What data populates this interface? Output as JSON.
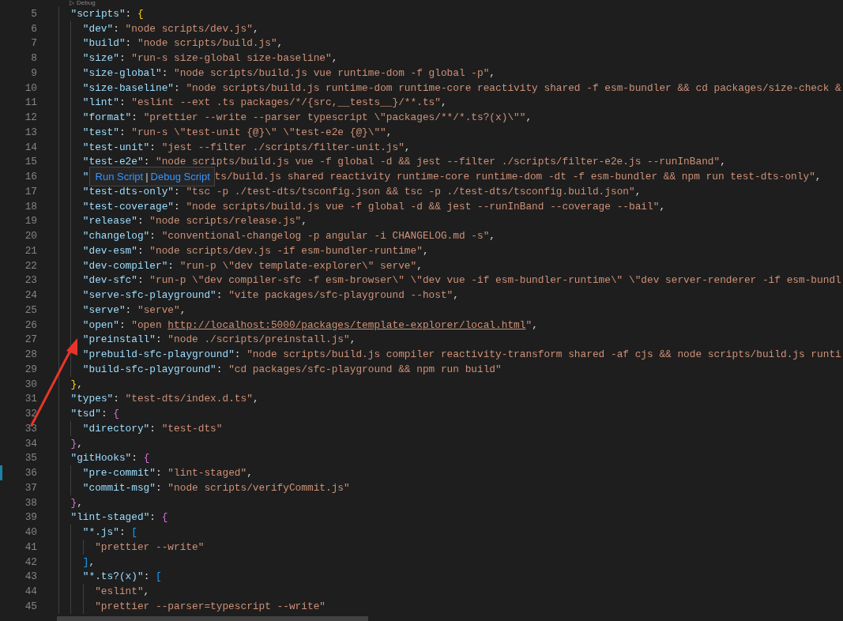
{
  "codelens": {
    "icon": "▷",
    "label": "Debug"
  },
  "lines": [
    {
      "number": "5",
      "changed": false,
      "tokens": [
        {
          "kind": "key",
          "text": "    \"scripts\""
        },
        {
          "kind": "punct",
          "text": ": "
        },
        {
          "kind": "b1",
          "text": "{"
        }
      ]
    },
    {
      "number": "6",
      "changed": false,
      "tokens": [
        {
          "kind": "key",
          "text": "      \"dev\""
        },
        {
          "kind": "punct",
          "text": ": "
        },
        {
          "kind": "str",
          "text": "\"node scripts/dev.js\""
        },
        {
          "kind": "punct",
          "text": ","
        }
      ]
    },
    {
      "number": "7",
      "changed": false,
      "tokens": [
        {
          "kind": "key",
          "text": "      \"build\""
        },
        {
          "kind": "punct",
          "text": ": "
        },
        {
          "kind": "str",
          "text": "\"node scripts/build.js\""
        },
        {
          "kind": "punct",
          "text": ","
        }
      ]
    },
    {
      "number": "8",
      "changed": false,
      "tokens": [
        {
          "kind": "key",
          "text": "      \"size\""
        },
        {
          "kind": "punct",
          "text": ": "
        },
        {
          "kind": "str",
          "text": "\"run-s size-global size-baseline\""
        },
        {
          "kind": "punct",
          "text": ","
        }
      ]
    },
    {
      "number": "9",
      "changed": false,
      "tokens": [
        {
          "kind": "key",
          "text": "      \"size-global\""
        },
        {
          "kind": "punct",
          "text": ": "
        },
        {
          "kind": "str",
          "text": "\"node scripts/build.js vue runtime-dom -f global -p\""
        },
        {
          "kind": "punct",
          "text": ","
        }
      ]
    },
    {
      "number": "10",
      "changed": false,
      "tokens": [
        {
          "kind": "key",
          "text": "      \"size-baseline\""
        },
        {
          "kind": "punct",
          "text": ": "
        },
        {
          "kind": "str",
          "text": "\"node scripts/build.js runtime-dom runtime-core reactivity shared -f esm-bundler && cd packages/size-check &"
        }
      ]
    },
    {
      "number": "11",
      "changed": false,
      "tokens": [
        {
          "kind": "key",
          "text": "      \"lint\""
        },
        {
          "kind": "punct",
          "text": ": "
        },
        {
          "kind": "str",
          "text": "\"eslint --ext .ts packages/*/{src,__tests__}/**.ts\""
        },
        {
          "kind": "punct",
          "text": ","
        }
      ]
    },
    {
      "number": "12",
      "changed": false,
      "tokens": [
        {
          "kind": "key",
          "text": "      \"format\""
        },
        {
          "kind": "punct",
          "text": ": "
        },
        {
          "kind": "str",
          "text": "\"prettier --write --parser typescript \\\"packages/**/*.ts?(x)\\\"\""
        },
        {
          "kind": "punct",
          "text": ","
        }
      ]
    },
    {
      "number": "13",
      "changed": false,
      "tokens": [
        {
          "kind": "key",
          "text": "      \"test\""
        },
        {
          "kind": "punct",
          "text": ": "
        },
        {
          "kind": "str",
          "text": "\"run-s \\\"test-unit {@}\\\" \\\"test-e2e {@}\\\"\""
        },
        {
          "kind": "punct",
          "text": ","
        }
      ]
    },
    {
      "number": "14",
      "changed": false,
      "tokens": [
        {
          "kind": "key",
          "text": "      \"test-unit\""
        },
        {
          "kind": "punct",
          "text": ": "
        },
        {
          "kind": "str",
          "text": "\"jest --filter ./scripts/filter-unit.js\""
        },
        {
          "kind": "punct",
          "text": ","
        }
      ]
    },
    {
      "number": "15",
      "changed": false,
      "tokens": [
        {
          "kind": "key",
          "text": "      \"test-e2e\""
        },
        {
          "kind": "punct",
          "text": ": "
        },
        {
          "kind": "str",
          "text": "\"node scripts/build.js vue -f global -d && jest --filter ./scripts/filter-e2e.js --runInBand\""
        },
        {
          "kind": "punct",
          "text": ","
        }
      ]
    },
    {
      "number": "16",
      "changed": false,
      "tokens": [
        {
          "kind": "key",
          "text": "      \""
        }
      ],
      "tooltip": {
        "links": [
          "Run Script",
          "Debug Script"
        ],
        "separator": "|"
      },
      "tokens_after": [
        {
          "kind": "str",
          "text": "ts/build.js shared reactivity runtime-core runtime-dom -dt -f esm-bundler && npm run test-dts-only\""
        },
        {
          "kind": "punct",
          "text": ","
        }
      ]
    },
    {
      "number": "17",
      "changed": false,
      "tokens": [
        {
          "kind": "key",
          "text": "      \"test-dts-only\""
        },
        {
          "kind": "punct",
          "text": ": "
        },
        {
          "kind": "str",
          "text": "\"tsc -p ./test-dts/tsconfig.json && tsc -p ./test-dts/tsconfig.build.json\""
        },
        {
          "kind": "punct",
          "text": ","
        }
      ]
    },
    {
      "number": "18",
      "changed": false,
      "tokens": [
        {
          "kind": "key",
          "text": "      \"test-coverage\""
        },
        {
          "kind": "punct",
          "text": ": "
        },
        {
          "kind": "str",
          "text": "\"node scripts/build.js vue -f global -d && jest --runInBand --coverage --bail\""
        },
        {
          "kind": "punct",
          "text": ","
        }
      ]
    },
    {
      "number": "19",
      "changed": false,
      "tokens": [
        {
          "kind": "key",
          "text": "      \"release\""
        },
        {
          "kind": "punct",
          "text": ": "
        },
        {
          "kind": "str",
          "text": "\"node scripts/release.js\""
        },
        {
          "kind": "punct",
          "text": ","
        }
      ]
    },
    {
      "number": "20",
      "changed": false,
      "tokens": [
        {
          "kind": "key",
          "text": "      \"changelog\""
        },
        {
          "kind": "punct",
          "text": ": "
        },
        {
          "kind": "str",
          "text": "\"conventional-changelog -p angular -i CHANGELOG.md -s\""
        },
        {
          "kind": "punct",
          "text": ","
        }
      ]
    },
    {
      "number": "21",
      "changed": false,
      "tokens": [
        {
          "kind": "key",
          "text": "      \"dev-esm\""
        },
        {
          "kind": "punct",
          "text": ": "
        },
        {
          "kind": "str",
          "text": "\"node scripts/dev.js -if esm-bundler-runtime\""
        },
        {
          "kind": "punct",
          "text": ","
        }
      ]
    },
    {
      "number": "22",
      "changed": false,
      "tokens": [
        {
          "kind": "key",
          "text": "      \"dev-compiler\""
        },
        {
          "kind": "punct",
          "text": ": "
        },
        {
          "kind": "str",
          "text": "\"run-p \\\"dev template-explorer\\\" serve\""
        },
        {
          "kind": "punct",
          "text": ","
        }
      ]
    },
    {
      "number": "23",
      "changed": false,
      "tokens": [
        {
          "kind": "key",
          "text": "      \"dev-sfc\""
        },
        {
          "kind": "punct",
          "text": ": "
        },
        {
          "kind": "str",
          "text": "\"run-p \\\"dev compiler-sfc -f esm-browser\\\" \\\"dev vue -if esm-bundler-runtime\\\" \\\"dev server-renderer -if esm-bundl"
        }
      ]
    },
    {
      "number": "24",
      "changed": false,
      "tokens": [
        {
          "kind": "key",
          "text": "      \"serve-sfc-playground\""
        },
        {
          "kind": "punct",
          "text": ": "
        },
        {
          "kind": "str",
          "text": "\"vite packages/sfc-playground --host\""
        },
        {
          "kind": "punct",
          "text": ","
        }
      ]
    },
    {
      "number": "25",
      "changed": false,
      "tokens": [
        {
          "kind": "key",
          "text": "      \"serve\""
        },
        {
          "kind": "punct",
          "text": ": "
        },
        {
          "kind": "str",
          "text": "\"serve\""
        },
        {
          "kind": "punct",
          "text": ","
        }
      ]
    },
    {
      "number": "26",
      "changed": false,
      "tokens": [
        {
          "kind": "key",
          "text": "      \"open\""
        },
        {
          "kind": "punct",
          "text": ": "
        },
        {
          "kind": "str",
          "text": "\"open "
        },
        {
          "kind": "link",
          "text": "http://localhost:5000/packages/template-explorer/local.html"
        },
        {
          "kind": "str",
          "text": "\""
        },
        {
          "kind": "punct",
          "text": ","
        }
      ]
    },
    {
      "number": "27",
      "changed": false,
      "tokens": [
        {
          "kind": "key",
          "text": "      \"preinstall\""
        },
        {
          "kind": "punct",
          "text": ": "
        },
        {
          "kind": "str",
          "text": "\"node ./scripts/preinstall.js\""
        },
        {
          "kind": "punct",
          "text": ","
        }
      ]
    },
    {
      "number": "28",
      "changed": false,
      "tokens": [
        {
          "kind": "key",
          "text": "      \"prebuild-sfc-playground\""
        },
        {
          "kind": "punct",
          "text": ": "
        },
        {
          "kind": "str",
          "text": "\"node scripts/build.js compiler reactivity-transform shared -af cjs && node scripts/build.js runti"
        }
      ]
    },
    {
      "number": "29",
      "changed": false,
      "tokens": [
        {
          "kind": "key",
          "text": "      \"build-sfc-playground\""
        },
        {
          "kind": "punct",
          "text": ": "
        },
        {
          "kind": "str",
          "text": "\"cd packages/sfc-playground && npm run build\""
        }
      ]
    },
    {
      "number": "30",
      "changed": false,
      "tokens": [
        {
          "kind": "b1",
          "text": "    }"
        },
        {
          "kind": "punct",
          "text": ","
        }
      ]
    },
    {
      "number": "31",
      "changed": false,
      "tokens": [
        {
          "kind": "key",
          "text": "    \"types\""
        },
        {
          "kind": "punct",
          "text": ": "
        },
        {
          "kind": "str",
          "text": "\"test-dts/index.d.ts\""
        },
        {
          "kind": "punct",
          "text": ","
        }
      ]
    },
    {
      "number": "32",
      "changed": false,
      "tokens": [
        {
          "kind": "key",
          "text": "    \"tsd\""
        },
        {
          "kind": "punct",
          "text": ": "
        },
        {
          "kind": "b2",
          "text": "{"
        }
      ]
    },
    {
      "number": "33",
      "changed": false,
      "tokens": [
        {
          "kind": "key",
          "text": "      \"directory\""
        },
        {
          "kind": "punct",
          "text": ": "
        },
        {
          "kind": "str",
          "text": "\"test-dts\""
        }
      ]
    },
    {
      "number": "34",
      "changed": false,
      "tokens": [
        {
          "kind": "b2",
          "text": "    }"
        },
        {
          "kind": "punct",
          "text": ","
        }
      ]
    },
    {
      "number": "35",
      "changed": false,
      "tokens": [
        {
          "kind": "key",
          "text": "    \"gitHooks\""
        },
        {
          "kind": "punct",
          "text": ": "
        },
        {
          "kind": "b2",
          "text": "{"
        }
      ]
    },
    {
      "number": "36",
      "changed": true,
      "tokens": [
        {
          "kind": "key",
          "text": "      \"pre-commit\""
        },
        {
          "kind": "punct",
          "text": ": "
        },
        {
          "kind": "str",
          "text": "\"lint-staged\""
        },
        {
          "kind": "punct",
          "text": ","
        }
      ]
    },
    {
      "number": "37",
      "changed": false,
      "tokens": [
        {
          "kind": "key",
          "text": "      \"commit-msg\""
        },
        {
          "kind": "punct",
          "text": ": "
        },
        {
          "kind": "str",
          "text": "\"node scripts/verifyCommit.js\""
        }
      ]
    },
    {
      "number": "38",
      "changed": false,
      "tokens": [
        {
          "kind": "b2",
          "text": "    }"
        },
        {
          "kind": "punct",
          "text": ","
        }
      ]
    },
    {
      "number": "39",
      "changed": false,
      "tokens": [
        {
          "kind": "key",
          "text": "    \"lint-staged\""
        },
        {
          "kind": "punct",
          "text": ": "
        },
        {
          "kind": "b2",
          "text": "{"
        }
      ]
    },
    {
      "number": "40",
      "changed": false,
      "tokens": [
        {
          "kind": "key",
          "text": "      \"*.js\""
        },
        {
          "kind": "punct",
          "text": ": "
        },
        {
          "kind": "b3",
          "text": "["
        }
      ]
    },
    {
      "number": "41",
      "changed": false,
      "tokens": [
        {
          "kind": "str",
          "text": "        \"prettier --write\""
        }
      ]
    },
    {
      "number": "42",
      "changed": false,
      "tokens": [
        {
          "kind": "b3",
          "text": "      ]"
        },
        {
          "kind": "punct",
          "text": ","
        }
      ]
    },
    {
      "number": "43",
      "changed": false,
      "tokens": [
        {
          "kind": "key",
          "text": "      \"*.ts?(x)\""
        },
        {
          "kind": "punct",
          "text": ": "
        },
        {
          "kind": "b3",
          "text": "["
        }
      ]
    },
    {
      "number": "44",
      "changed": false,
      "tokens": [
        {
          "kind": "str",
          "text": "        \"eslint\""
        },
        {
          "kind": "punct",
          "text": ","
        }
      ]
    },
    {
      "number": "45",
      "changed": false,
      "tokens": [
        {
          "kind": "str",
          "text": "        \"prettier --parser=typescript --write\""
        }
      ]
    }
  ]
}
